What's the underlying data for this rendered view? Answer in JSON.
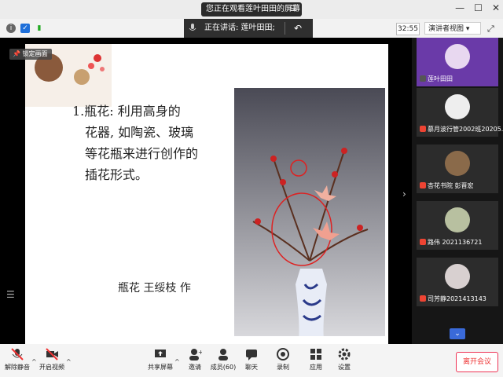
{
  "titlebar": {
    "share_notice": "您正在观看莲叶田田的屏幕"
  },
  "topbar": {
    "speaking_label": "正在讲话: 莲叶田田;",
    "timer": "32:55",
    "view_mode": "演讲者视图"
  },
  "stage": {
    "lock_label": "锁定画面",
    "slide": {
      "line1": "1.瓶花: 利用高身的",
      "line2": "花器, 如陶瓷、玻璃",
      "line3": "等花瓶来进行创作的",
      "line4": "插花形式。",
      "caption": "瓶花 王绥枝 作"
    }
  },
  "participants": [
    {
      "name": "莲叶田田",
      "muted": false
    },
    {
      "name": "慕月波行管2002班20205...",
      "muted": true
    },
    {
      "name": "杏花书院 彭晋宏",
      "muted": true
    },
    {
      "name": "路伟 2021136721",
      "muted": true
    },
    {
      "name": "司芳静2021413143",
      "muted": true
    }
  ],
  "toolbar": {
    "unmute": "解除静音",
    "start_video": "开启视频",
    "share": "共享屏幕",
    "invite": "邀请",
    "members": "成员(60)",
    "chat": "聊天",
    "record": "录制",
    "apps": "应用",
    "settings": "设置",
    "leave": "离开会议"
  },
  "colors": {
    "accent": "#e53935",
    "bar": "#f4f4f4"
  }
}
